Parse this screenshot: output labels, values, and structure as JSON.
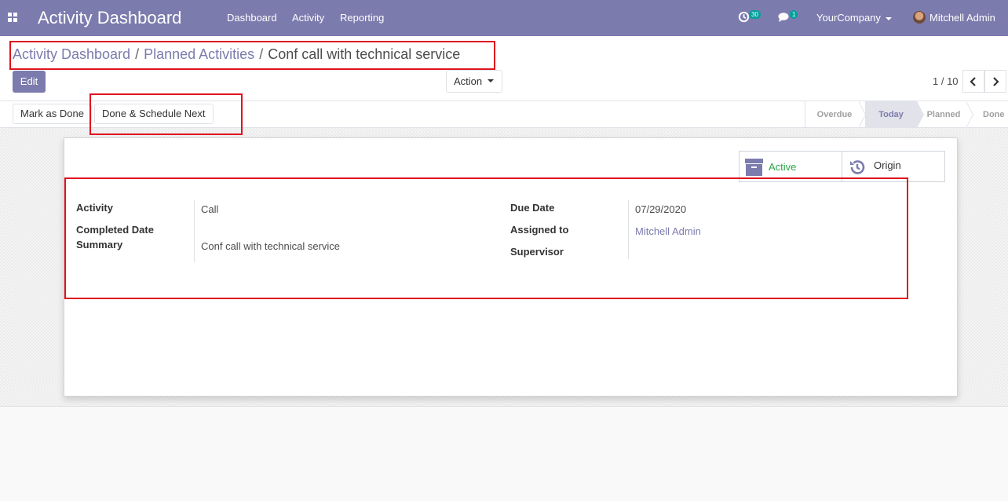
{
  "navbar": {
    "brand": "Activity Dashboard",
    "menu": [
      "Dashboard",
      "Activity",
      "Reporting"
    ],
    "activity_badge": "30",
    "message_badge": "1",
    "company": "YourCompany",
    "user": "Mitchell Admin",
    "icons": [
      "apps-icon",
      "clock-icon",
      "comments-icon",
      "avatar"
    ]
  },
  "breadcrumb": {
    "items": [
      "Activity Dashboard",
      "Planned Activities"
    ],
    "separator": "/",
    "current": "Conf call with technical service"
  },
  "buttons": {
    "edit": "Edit",
    "action": "Action",
    "mark_done": "Mark as Done",
    "done_schedule": "Done & Schedule Next"
  },
  "pager": {
    "value": "1 / 10"
  },
  "statusbar": {
    "stages": [
      "Overdue",
      "Today",
      "Planned",
      "Done"
    ],
    "active_stage": "Today"
  },
  "smart_buttons": {
    "active": "Active",
    "origin": "Origin"
  },
  "form": {
    "left": [
      {
        "label": "Activity",
        "value": "Call"
      },
      {
        "label": "Completed Date",
        "value": ""
      },
      {
        "label": "Summary",
        "value": "Conf call with technical service"
      }
    ],
    "right": [
      {
        "label": "Due Date",
        "value": "07/29/2020"
      },
      {
        "label": "Assigned to",
        "value": "Mitchell Admin"
      },
      {
        "label": "Supervisor",
        "value": ""
      }
    ]
  },
  "colors": {
    "brand": "#7c7bad",
    "badge": "#00a09d",
    "active_green": "#28a745",
    "annotation": "#e0141e"
  }
}
